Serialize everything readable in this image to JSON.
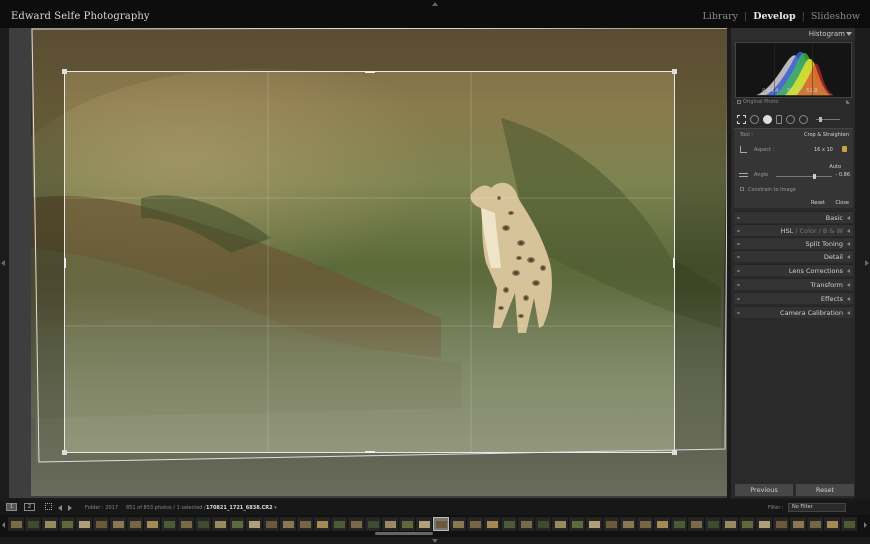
{
  "identity_plate": "Edward Selfe Photography",
  "modules": {
    "library": "Library",
    "develop": "Develop",
    "slideshow": "Slideshow",
    "separator": "|"
  },
  "histogram": {
    "title": "Histogram",
    "r_label": "R",
    "r_value": "64.4",
    "g_label": "G",
    "g_value": "57.7",
    "b_label": "B",
    "b_value": "51.8",
    "unit": "%",
    "original_photo": "Original Photo"
  },
  "crop": {
    "tool_label": "Tool :",
    "tool_name": "Crop & Straighten",
    "aspect_label": "Aspect :",
    "aspect_value": "16 x 10",
    "auto_label": "Auto",
    "angle_label": "Angle",
    "angle_value": "- 0.86",
    "constrain": "Constrain to Image",
    "reset": "Reset",
    "close": "Close"
  },
  "sections": {
    "basic": "Basic",
    "hsl": "HSL",
    "color": "Color",
    "bw": "B & W",
    "split_toning": "Split Toning",
    "detail": "Detail",
    "lens_corrections": "Lens Corrections",
    "transform": "Transform",
    "effects": "Effects",
    "camera_calibration": "Camera Calibration"
  },
  "buttons": {
    "previous": "Previous",
    "reset": "Reset"
  },
  "filmbar": {
    "monitor1": "1",
    "monitor2": "2",
    "folder": "Folder : 2017",
    "count": "851 of 853 photos / 1 selected /",
    "filename": "170821_1721_6838.CR2",
    "filter_label": "Filter :",
    "filter_value": "No Filter"
  },
  "colors": {
    "accent_lock": "#c9a43a",
    "panel": "#2a2a2a",
    "background": "#1b1b1b"
  }
}
